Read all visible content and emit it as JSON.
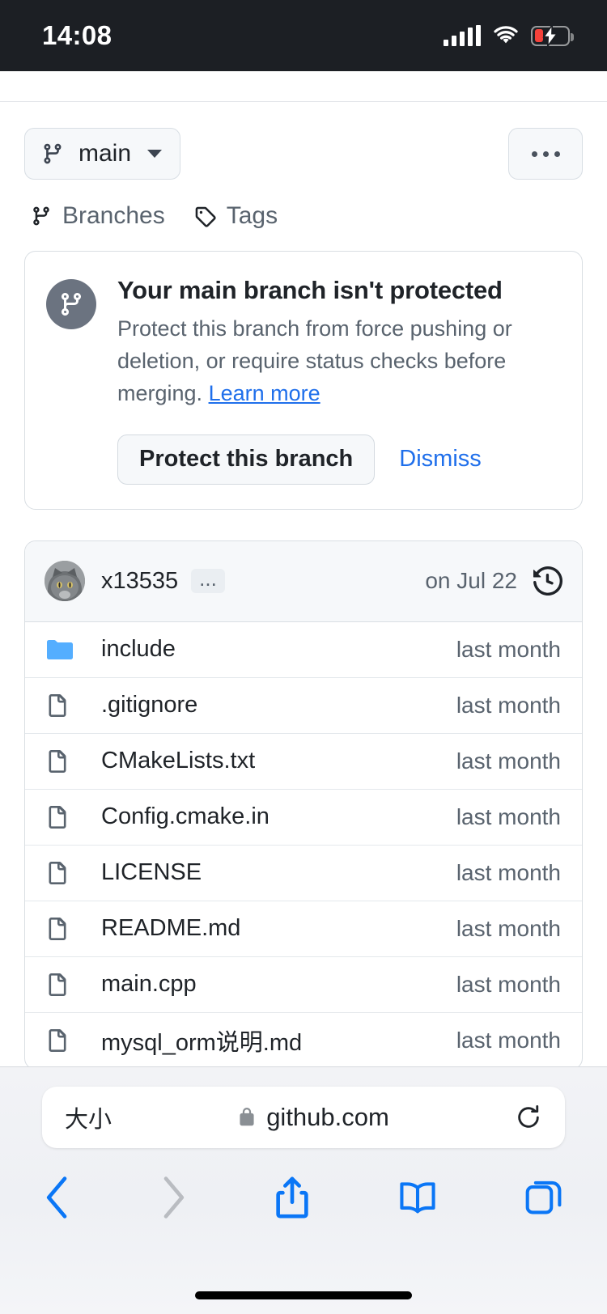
{
  "status_bar": {
    "time": "14:08",
    "signal_icon": "cellular-signal-icon",
    "wifi_icon": "wifi-icon",
    "battery_icon": "battery-charging-low-icon"
  },
  "repo": {
    "branch_button": {
      "label": "main",
      "icon": "git-branch-icon",
      "caret_icon": "chevron-down-icon"
    },
    "more_button": {
      "icon": "kebab-horizontal-icon"
    },
    "refs_nav": [
      {
        "label": "Branches",
        "icon": "git-branch-icon"
      },
      {
        "label": "Tags",
        "icon": "tag-icon"
      }
    ]
  },
  "notice": {
    "icon": "shield-branch-icon",
    "title": "Your main branch isn't protected",
    "body": "Protect this branch from force pushing or deletion, or require status checks before merging.",
    "learn_more": "Learn more",
    "primary_button": "Protect this branch",
    "dismiss_button": "Dismiss"
  },
  "commit_header": {
    "avatar_icon": "user-avatar-cat",
    "author": "x13535",
    "message_badge": "...",
    "date": "on Jul 22",
    "history_icon": "history-icon"
  },
  "files": {
    "columns": [
      "name",
      "last_commit_time"
    ],
    "rows": [
      {
        "name": "include",
        "type": "folder",
        "icon": "folder-icon",
        "time": "last month"
      },
      {
        "name": ".gitignore",
        "type": "file",
        "icon": "file-icon",
        "time": "last month"
      },
      {
        "name": "CMakeLists.txt",
        "type": "file",
        "icon": "file-icon",
        "time": "last month"
      },
      {
        "name": "Config.cmake.in",
        "type": "file",
        "icon": "file-icon",
        "time": "last month"
      },
      {
        "name": "LICENSE",
        "type": "file",
        "icon": "file-icon",
        "time": "last month"
      },
      {
        "name": "README.md",
        "type": "file",
        "icon": "file-icon",
        "time": "last month"
      },
      {
        "name": "main.cpp",
        "type": "file",
        "icon": "file-icon",
        "time": "last month"
      },
      {
        "name": "mysql_orm说明.md",
        "type": "file",
        "icon": "file-icon",
        "time": "last month"
      }
    ]
  },
  "browser": {
    "page_settings_label": "大小",
    "lock_icon": "lock-icon",
    "url": "github.com",
    "reload_icon": "reload-icon",
    "toolbar": [
      {
        "name": "back",
        "icon": "chevron-left-icon",
        "enabled": true
      },
      {
        "name": "forward",
        "icon": "chevron-right-icon",
        "enabled": false
      },
      {
        "name": "share",
        "icon": "share-icon",
        "enabled": true
      },
      {
        "name": "bookmarks",
        "icon": "book-icon",
        "enabled": true
      },
      {
        "name": "tabs",
        "icon": "tabs-icon",
        "enabled": true
      }
    ]
  },
  "colors": {
    "accent_blue": "#1f6feb",
    "safari_blue": "#0a76f6",
    "folder_blue": "#54aeff",
    "muted_text": "#59636e",
    "border": "#d9dee3",
    "surface": "#f6f8fa",
    "battery_red": "#f4413a"
  }
}
